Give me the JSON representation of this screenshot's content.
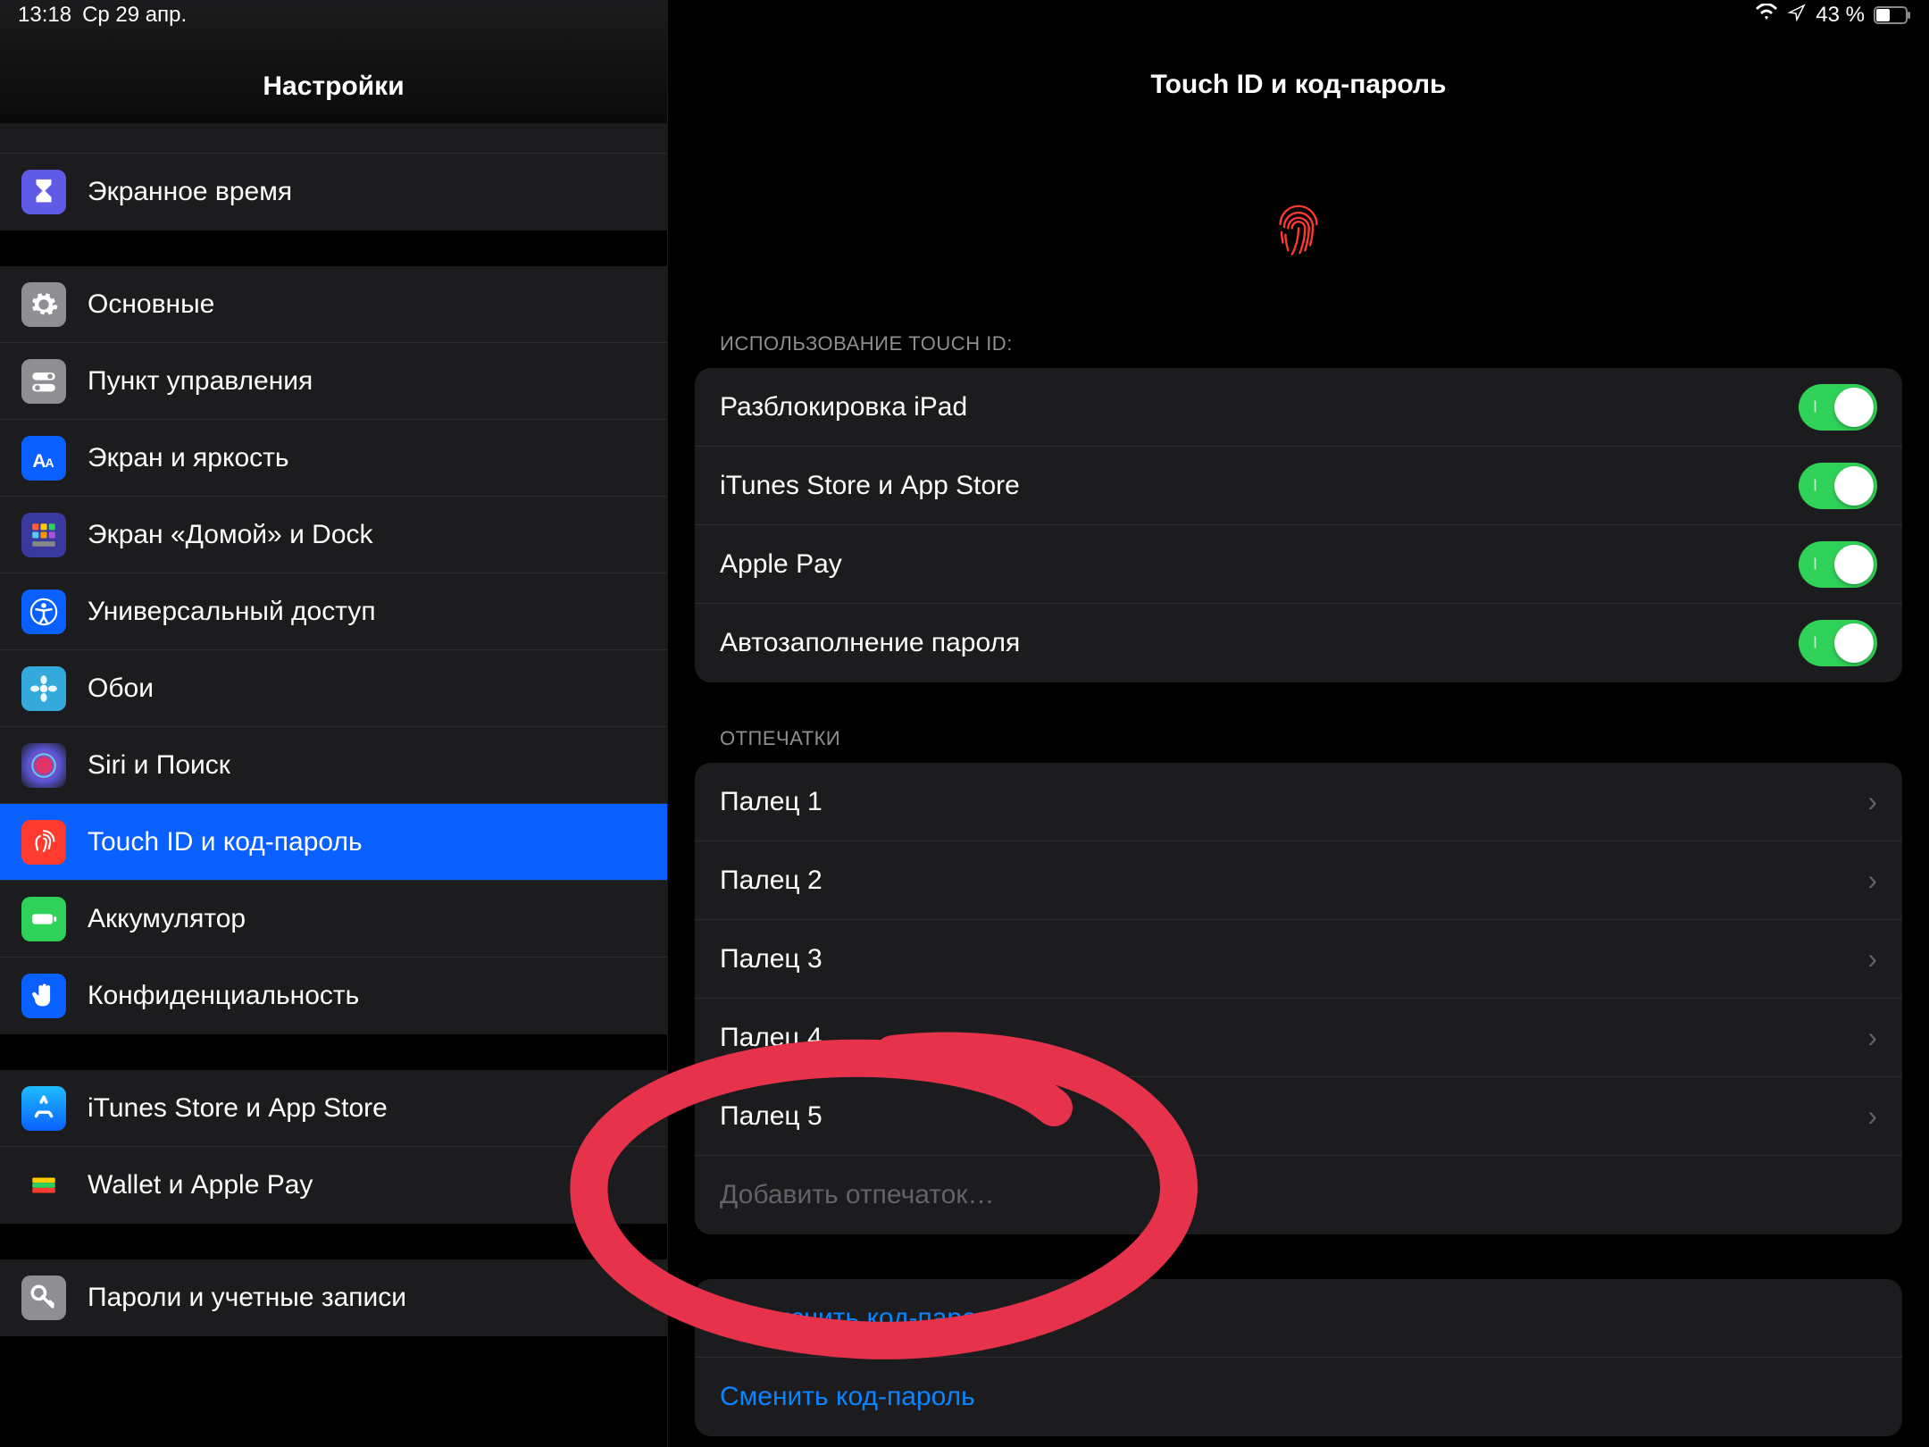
{
  "status_bar": {
    "time": "13:18",
    "date": "Ср 29 апр.",
    "battery": "43 %"
  },
  "sidebar": {
    "title": "Настройки",
    "items": [
      {
        "label": "Экранное время",
        "icon": "hourglass-icon",
        "bg": "#5e5ce6"
      },
      {
        "label": "Основные",
        "icon": "gear-icon",
        "bg": "#8e8e93"
      },
      {
        "label": "Пункт управления",
        "icon": "switches-icon",
        "bg": "#8e8e93"
      },
      {
        "label": "Экран и яркость",
        "icon": "text-size-icon",
        "bg": "#0a60ff"
      },
      {
        "label": "Экран «Домой» и Dock",
        "icon": "grid-icon",
        "bg": "#3a3a9e"
      },
      {
        "label": "Универсальный доступ",
        "icon": "accessibility-icon",
        "bg": "#0a60ff"
      },
      {
        "label": "Обои",
        "icon": "flower-icon",
        "bg": "#34aadc"
      },
      {
        "label": "Siri и Поиск",
        "icon": "siri-icon",
        "bg": "#1c1c1e"
      },
      {
        "label": "Touch ID и код-пароль",
        "icon": "fingerprint-icon",
        "bg": "#ff3b30",
        "selected": true
      },
      {
        "label": "Аккумулятор",
        "icon": "battery-icon",
        "bg": "#30d158"
      },
      {
        "label": "Конфиденциальность",
        "icon": "hand-icon",
        "bg": "#0a60ff"
      },
      {
        "label": "iTunes Store и App Store",
        "icon": "appstore-icon",
        "bg": "#0a84ff"
      },
      {
        "label": "Wallet и Apple Pay",
        "icon": "wallet-icon",
        "bg": "#1c1c1e"
      },
      {
        "label": "Пароли и учетные записи",
        "icon": "key-icon",
        "bg": "#8e8e93"
      }
    ]
  },
  "detail": {
    "title": "Touch ID и код-пароль",
    "usage_header": "ИСПОЛЬЗОВАНИЕ TOUCH ID:",
    "usage_rows": [
      {
        "label": "Разблокировка iPad",
        "on": true
      },
      {
        "label": "iTunes Store и App Store",
        "on": true
      },
      {
        "label": "Apple Pay",
        "on": true
      },
      {
        "label": "Автозаполнение пароля",
        "on": true
      }
    ],
    "fingerprints_header": "ОТПЕЧАТКИ",
    "fingerprints": [
      {
        "label": "Палец 1"
      },
      {
        "label": "Палец 2"
      },
      {
        "label": "Палец 3"
      },
      {
        "label": "Палец 4"
      },
      {
        "label": "Палец 5"
      }
    ],
    "add_fingerprint": "Добавить отпечаток…",
    "passcode_actions": [
      {
        "label": "Выключить код-пароль"
      },
      {
        "label": "Сменить код-пароль"
      }
    ]
  }
}
